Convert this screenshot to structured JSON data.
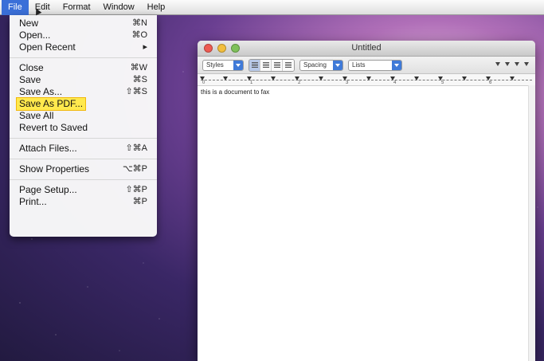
{
  "menubar": {
    "items": [
      "File",
      "Edit",
      "Format",
      "Window",
      "Help"
    ],
    "active": "File"
  },
  "file_menu": {
    "groups": [
      [
        {
          "label": "New",
          "shortcut": "⌘N"
        },
        {
          "label": "Open...",
          "shortcut": "⌘O"
        },
        {
          "label": "Open Recent",
          "shortcut": "▸"
        }
      ],
      [
        {
          "label": "Close",
          "shortcut": "⌘W"
        },
        {
          "label": "Save",
          "shortcut": "⌘S"
        },
        {
          "label": "Save As...",
          "shortcut": "⇧⌘S"
        },
        {
          "label": "Save As PDF...",
          "shortcut": "",
          "highlighted": true
        },
        {
          "label": "Save All",
          "shortcut": ""
        },
        {
          "label": "Revert to Saved",
          "shortcut": ""
        }
      ],
      [
        {
          "label": "Attach Files...",
          "shortcut": "⇧⌘A"
        }
      ],
      [
        {
          "label": "Show Properties",
          "shortcut": "⌥⌘P"
        }
      ],
      [
        {
          "label": "Page Setup...",
          "shortcut": "⇧⌘P"
        },
        {
          "label": "Print...",
          "shortcut": "⌘P"
        }
      ]
    ]
  },
  "window": {
    "title": "Untitled",
    "toolbar": {
      "styles": "Styles",
      "spacing": "Spacing",
      "lists": "Lists"
    },
    "ruler_numbers": [
      "0",
      "1",
      "2",
      "3",
      "4",
      "5",
      "6"
    ],
    "document_text": "this is a document to fax"
  },
  "colors": {
    "menu_active": "#3a6fd8",
    "highlight_fill": "#ffe94d",
    "highlight_border": "#f1b80b"
  }
}
